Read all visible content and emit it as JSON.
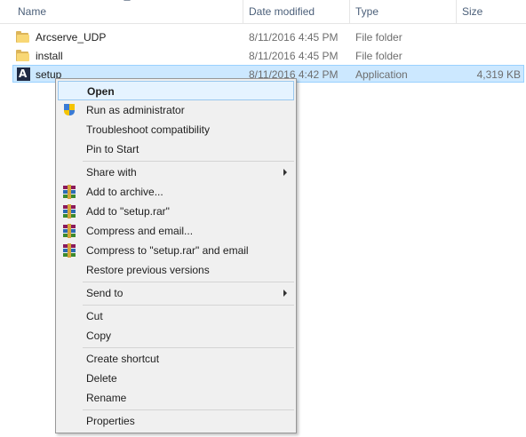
{
  "columns": {
    "name": "Name",
    "date": "Date modified",
    "type": "Type",
    "size": "Size"
  },
  "files": [
    {
      "name": "Arcserve_UDP",
      "date": "8/11/2016 4:45 PM",
      "type": "File folder",
      "size": "",
      "icon": "folder-icon"
    },
    {
      "name": "install",
      "date": "8/11/2016 4:45 PM",
      "type": "File folder",
      "size": "",
      "icon": "folder-icon"
    },
    {
      "name": "setup",
      "date": "8/11/2016 4:42 PM",
      "type": "Application",
      "size": "4,319 KB",
      "icon": "app-icon",
      "selected": true
    }
  ],
  "menu": {
    "items": [
      {
        "label": "Open",
        "bold": true,
        "highlighted": true
      },
      {
        "label": "Run as administrator",
        "icon": "uac-shield-icon"
      },
      {
        "label": "Troubleshoot compatibility"
      },
      {
        "label": "Pin to Start"
      },
      {
        "label": "Share with",
        "submenu": true
      },
      {
        "label": "Add to archive...",
        "icon": "winrar-icon"
      },
      {
        "label": "Add to \"setup.rar\"",
        "icon": "winrar-icon"
      },
      {
        "label": "Compress and email...",
        "icon": "winrar-icon"
      },
      {
        "label": "Compress to \"setup.rar\" and email",
        "icon": "winrar-icon"
      },
      {
        "label": "Restore previous versions"
      },
      {
        "label": "Send to",
        "submenu": true
      },
      {
        "label": "Cut"
      },
      {
        "label": "Copy"
      },
      {
        "label": "Create shortcut"
      },
      {
        "label": "Delete"
      },
      {
        "label": "Rename"
      },
      {
        "label": "Properties"
      }
    ]
  },
  "colors": {
    "selection": "#cce8ff",
    "menu_highlight": "#e5f3ff",
    "header_text": "#4c607a"
  }
}
